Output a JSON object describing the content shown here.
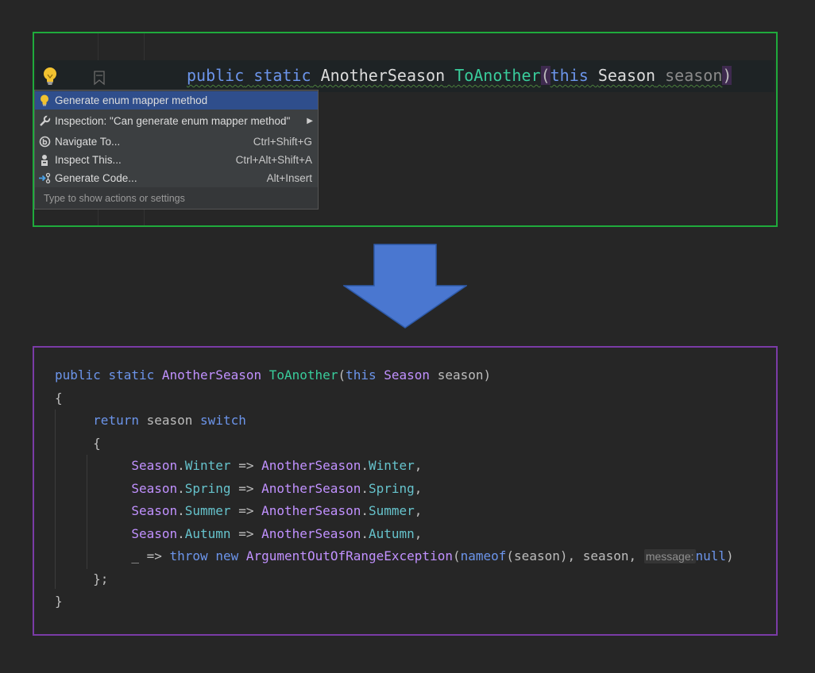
{
  "top": {
    "code_tokens": {
      "public": "public",
      "static": "static",
      "return_type": "AnotherSeason",
      "method_name": "ToAnother",
      "open_paren": "(",
      "this_kw": "this",
      "param_type": "Season",
      "param_name": "season",
      "close_paren": ")"
    }
  },
  "menu": {
    "items": [
      {
        "label": "Generate enum mapper method",
        "shortcut": "",
        "icon": "lightbulb-icon"
      },
      {
        "label": "Inspection: \"Can generate enum mapper method\"",
        "shortcut": "",
        "icon": "wrench-icon"
      },
      {
        "label": "Navigate To...",
        "shortcut": "Ctrl+Shift+G",
        "icon": "navigate-icon"
      },
      {
        "label": "Inspect This...",
        "shortcut": "Ctrl+Alt+Shift+A",
        "icon": "inspect-icon"
      },
      {
        "label": "Generate Code...",
        "shortcut": "Alt+Insert",
        "icon": "generate-code-icon"
      }
    ],
    "hint": "Type to show actions or settings"
  },
  "bottom": {
    "tokens": {
      "public": "public",
      "static": "static",
      "return_type": "AnotherSeason",
      "method_name": "ToAnother",
      "this_kw": "this",
      "param_type": "Season",
      "param_name": "season",
      "open_brace": "{",
      "close_brace": "}",
      "return_kw": "return",
      "switch_kw": "switch",
      "close_switch": "};",
      "discard": "_",
      "arrow": "=>",
      "throw_kw": "throw",
      "new_kw": "new",
      "exception": "ArgumentOutOfRangeException",
      "nameof": "nameof",
      "hint_label": "message:",
      "null_kw": "null"
    },
    "cases": [
      {
        "source": "Winter",
        "target": "Winter"
      },
      {
        "source": "Spring",
        "target": "Spring"
      },
      {
        "source": "Summer",
        "target": "Summer"
      },
      {
        "source": "Autumn",
        "target": "Autumn"
      }
    ],
    "enum_source": "Season",
    "enum_target": "AnotherSeason"
  },
  "colors": {
    "top_border": "#1faa3c",
    "bottom_border": "#7a3ba6",
    "arrow": "#4a77d0",
    "keyword": "#6c95eb",
    "type": "#c191ff",
    "method": "#39cc9b",
    "enum_member": "#66c3cc",
    "menu_selected": "#2f4e8c"
  }
}
